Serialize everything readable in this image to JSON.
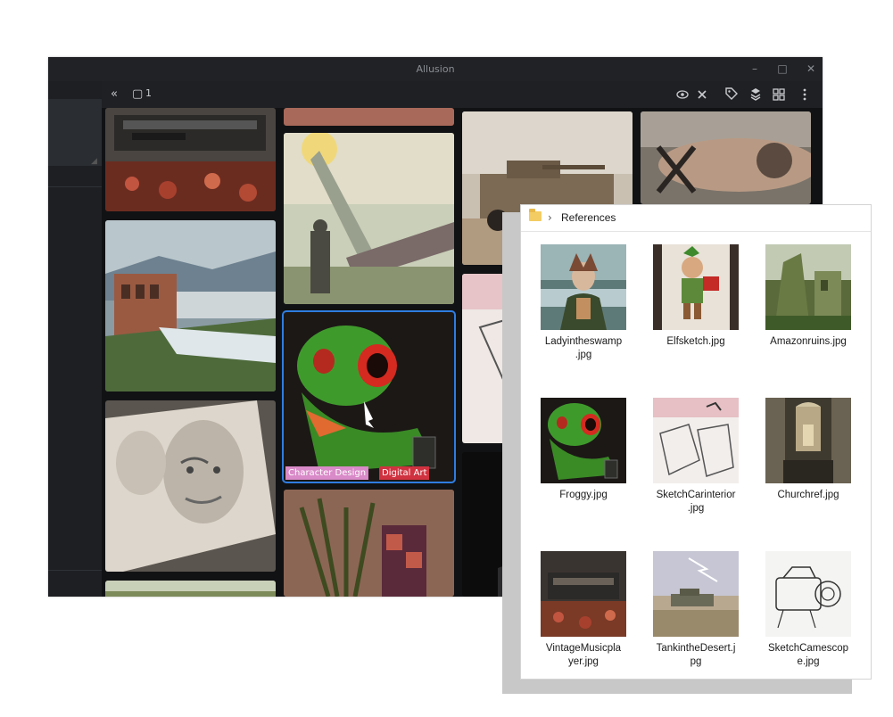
{
  "app": {
    "title": "Allusion",
    "window_controls": [
      "–",
      "□",
      "✕"
    ],
    "toolbar": {
      "collapse_icon": "«",
      "selection_icon": "▢",
      "selection_count": "1",
      "right_icons": [
        "eye-icon",
        "close-icon",
        "tag-icon",
        "layers-icon",
        "grid-icon",
        "more-icon"
      ]
    },
    "selected_tags": [
      {
        "label": "Character Design",
        "color": "#d98ac8"
      },
      {
        "label": "Digital Art",
        "color": "#d0323f"
      }
    ]
  },
  "explorer": {
    "path": "References",
    "files": [
      {
        "name": "Ladyintheswamp\n.jpg",
        "kind": "lady"
      },
      {
        "name": "Elfsketch.jpg",
        "kind": "elf"
      },
      {
        "name": "Amazonruins.jpg",
        "kind": "ruins"
      },
      {
        "name": "Froggy.jpg",
        "kind": "frog"
      },
      {
        "name": "SketchCarinterior\n.jpg",
        "kind": "carsketch"
      },
      {
        "name": "Churchref.jpg",
        "kind": "church"
      },
      {
        "name": "VintageMusicpla\nyer.jpg",
        "kind": "music"
      },
      {
        "name": "TankintheDesert.j\npg",
        "kind": "tank"
      },
      {
        "name": "SketchCamescop\ne.jpg",
        "kind": "camera"
      }
    ]
  }
}
